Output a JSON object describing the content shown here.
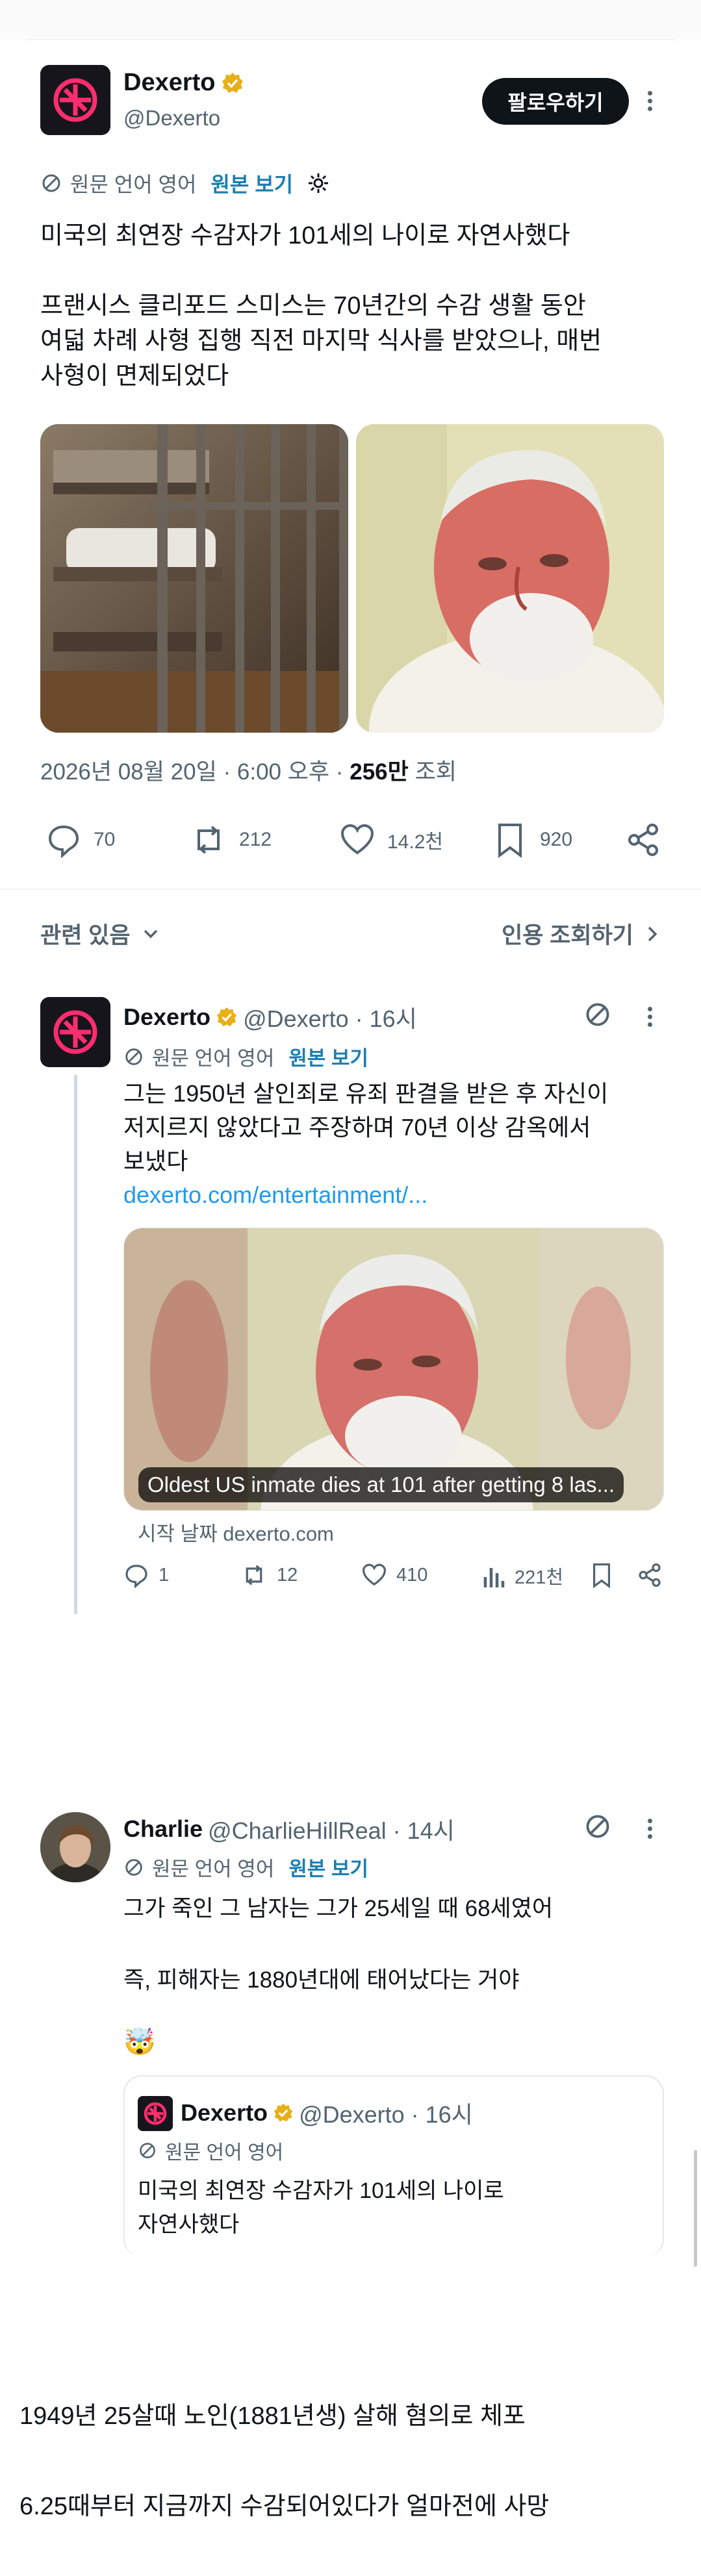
{
  "main_tweet": {
    "author_name": "Dexerto",
    "handle": "@Dexerto",
    "follow_label": "팔로우하기",
    "translation": {
      "note": "원문 언어 영어",
      "show_original": "원본 보기"
    },
    "text_line1": "미국의 최연장 수감자가 101세의 나이로 자연사했다",
    "text_para2": [
      "프랜시스 클리포드 스미스는 70년간의 수감 생활 동안",
      "여덟 차례 사형 집행 직전 마지막 식사를 받았으나, 매번",
      "사형이 면제되었다"
    ],
    "timestamp": "2026년 08월 20일 · 6:00 오후",
    "views_count": "256만",
    "views_label": "조회",
    "stats": {
      "replies": "70",
      "retweets": "212",
      "likes": "14.2천",
      "bookmarks": "920"
    }
  },
  "related_bar": {
    "related_label": "관련 있음",
    "quotes_label": "인용 조회하기"
  },
  "reply1": {
    "author_name": "Dexerto",
    "handle_time": "@Dexerto · 16시",
    "translation": {
      "note": "원문 언어 영어",
      "show_original": "원본 보기"
    },
    "text_lines": [
      "그는 1950년 살인죄로 유죄 판결을 받은 후 자신이",
      "저지르지 않았다고 주장하며 70년 이상 감옥에서",
      "보냈다"
    ],
    "link": "dexerto.com/entertainment/...",
    "card_caption": "Oldest US inmate dies at 101 after getting 8 las...",
    "card_source": "시작 날짜 dexerto.com",
    "stats": {
      "replies": "1",
      "retweets": "12",
      "likes": "410",
      "views": "221천"
    }
  },
  "reply2": {
    "author_name": "Charlie",
    "handle_time": "@CharlieHillReal · 14시",
    "translation": {
      "note": "원문 언어 영어",
      "show_original": "원본 보기"
    },
    "text_line1": "그가 죽인 그 남자는 그가 25세일 때 68세였어",
    "text_line2": "즉, 피해자는 1880년대에 태어났다는 거야",
    "emoji": "🤯",
    "quote": {
      "author_name": "Dexerto",
      "handle_time": "@Dexerto · 16시",
      "translation_note": "원문 언어 영어",
      "text_lines": [
        "미국의 최연장 수감자가 101세의 나이로",
        "자연사했다"
      ]
    }
  },
  "footer_lines": [
    "1949년 25살때 노인(1881년생) 살해 혐의로 체포",
    "6.25때부터 지금까지 수감되어있다가 얼마전에 사망"
  ]
}
